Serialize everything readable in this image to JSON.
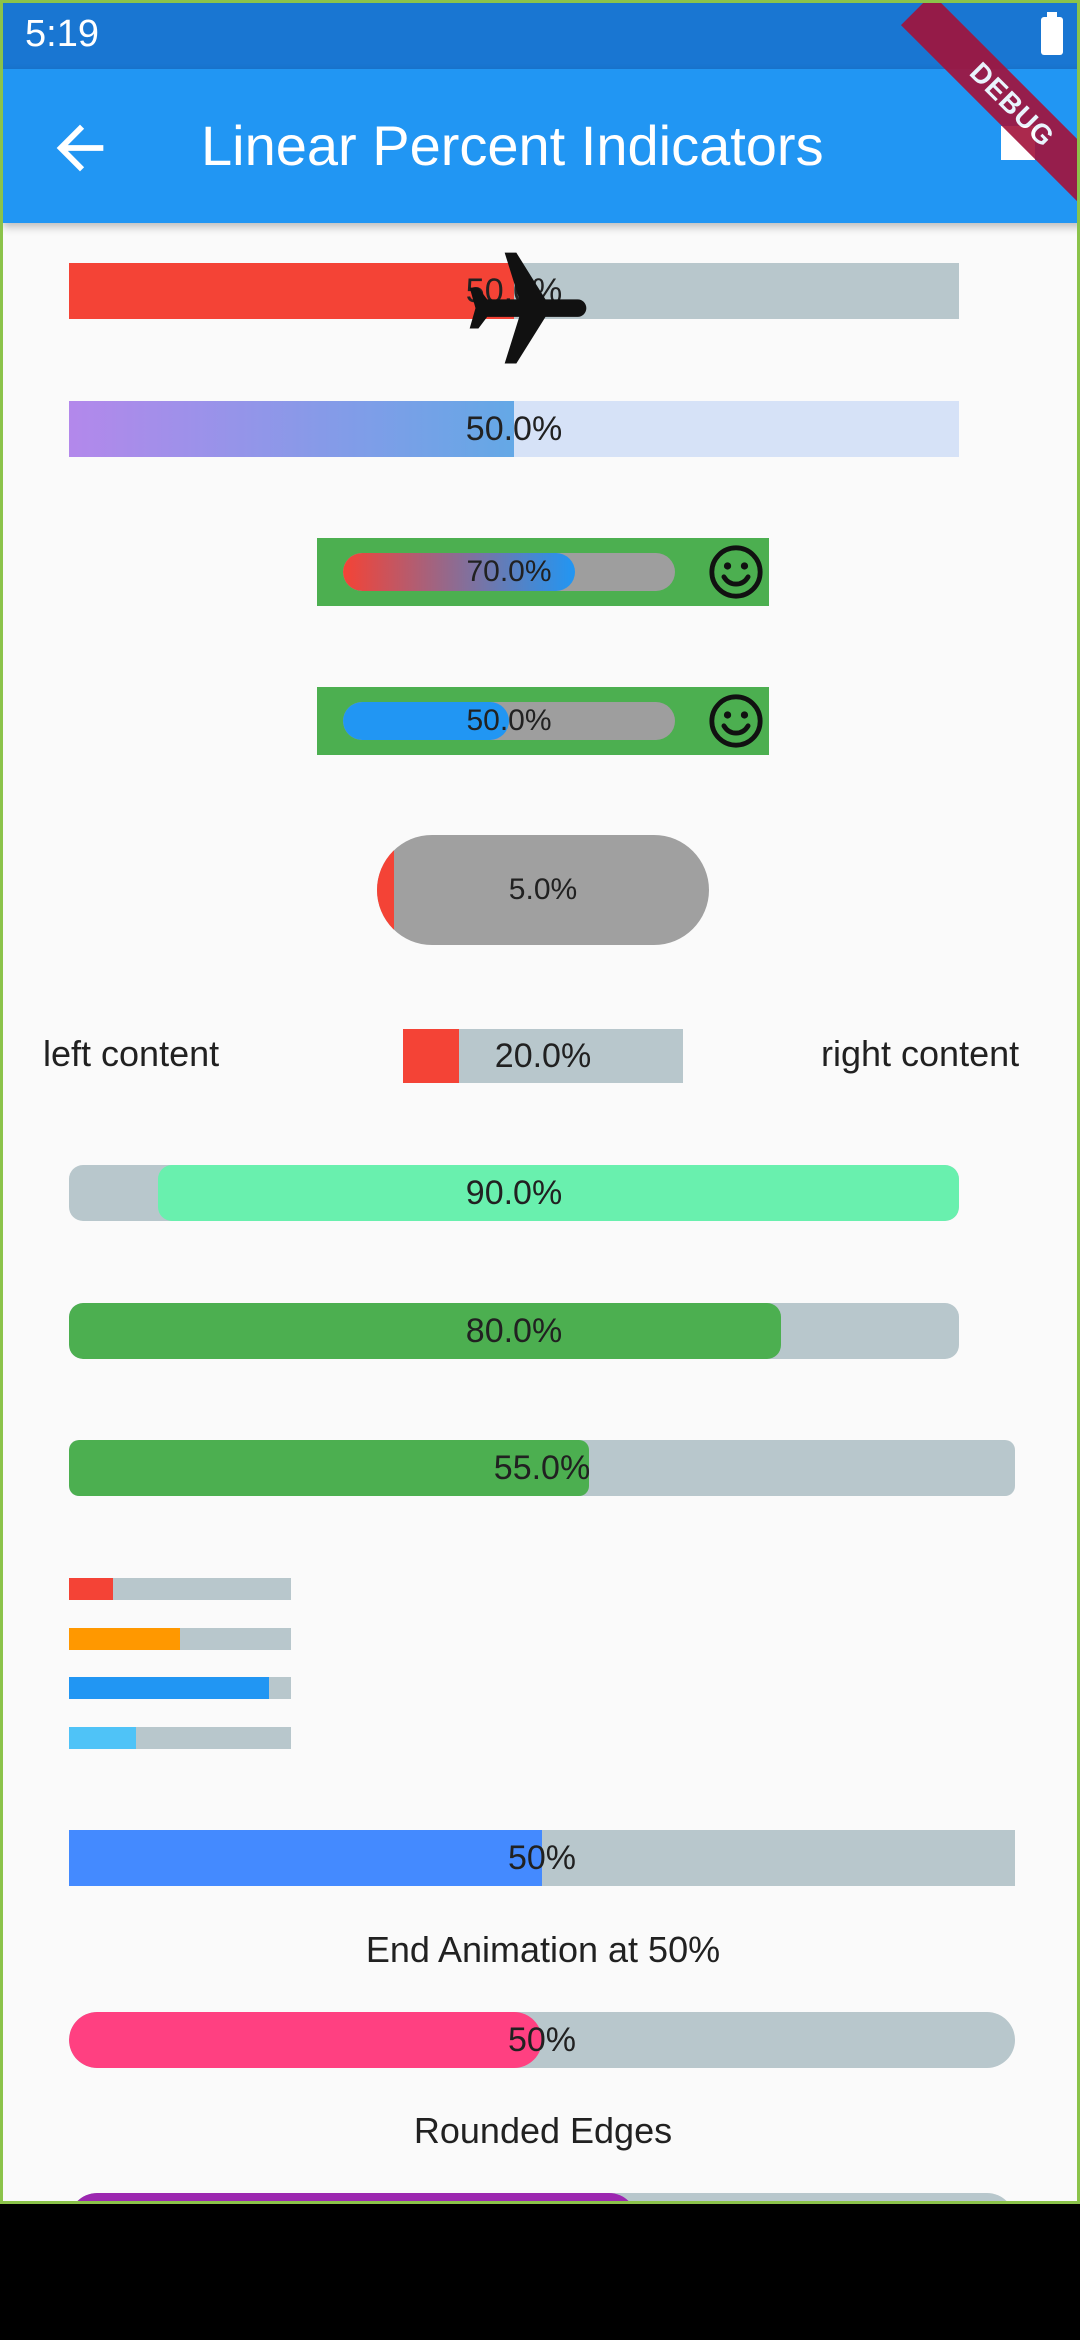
{
  "status_bar": {
    "time": "5:19"
  },
  "app_bar": {
    "title": "Linear Percent Indicators",
    "debug_label": "DEBUG"
  },
  "colors": {
    "app_bar": "#2196f3",
    "status_bar": "#1976d2",
    "track": "#b8c7cc",
    "red": "#f44336",
    "green": "#4caf50",
    "blue": "#2196f3",
    "pink": "#ff4081",
    "purple": "#9c27b0"
  },
  "indicators": [
    {
      "label": "50.0%",
      "percent": 0.5,
      "color": "#f44336",
      "icon": "airplane-icon"
    },
    {
      "label": "50.0%",
      "percent": 0.5,
      "gradient": [
        "#b388eb",
        "#64a8e6"
      ],
      "track": "#d6e2f7"
    },
    {
      "label": "70.0%",
      "percent": 0.7,
      "gradient": [
        "#f44336",
        "#2196f3"
      ],
      "trailing_icon": "smile-icon"
    },
    {
      "label": "50.0%",
      "percent": 0.5,
      "color": "#2196f3",
      "trailing_icon": "smile-icon"
    },
    {
      "label": "5.0%",
      "percent": 0.05,
      "color": "#f44336"
    },
    {
      "label": "20.0%",
      "percent": 0.2,
      "color": "#f44336",
      "leading": "left content",
      "trailing": "right content"
    },
    {
      "label": "90.0%",
      "percent": 0.9,
      "color": "#69f0ae",
      "reverse": true
    },
    {
      "label": "80.0%",
      "percent": 0.8,
      "color": "#4caf50"
    },
    {
      "label": "55.0%",
      "percent": 0.55,
      "color": "#4caf50"
    },
    {
      "label": "50%",
      "percent": 0.5,
      "color": "#448aff",
      "caption": "End Animation at 50%"
    },
    {
      "label": "50%",
      "percent": 0.5,
      "color": "#ff4081",
      "caption": "Rounded Edges"
    },
    {
      "label": "",
      "percent": 0.6,
      "color": "#9c27b0"
    }
  ],
  "mini_bars": [
    {
      "percent": 0.2,
      "color": "#f44336"
    },
    {
      "percent": 0.5,
      "color": "#ff9800"
    },
    {
      "percent": 0.9,
      "color": "#2196f3"
    },
    {
      "percent": 0.3,
      "color": "#4fc3f7"
    }
  ]
}
